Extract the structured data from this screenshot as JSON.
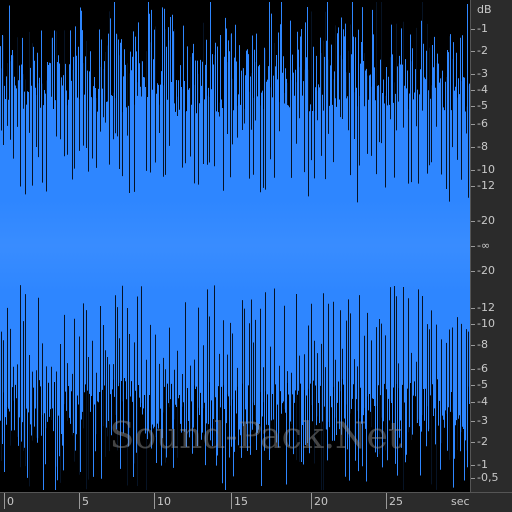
{
  "colors": {
    "background": "#000000",
    "waveform": "#2e86ff",
    "ruler_bg": "#2b2b2b",
    "ruler_text": "#c8c8c8"
  },
  "watermark": "Sound-Pack.Net",
  "db_ruler": {
    "unit": "dB",
    "labels": [
      "-1",
      "-2",
      "-3",
      "-4",
      "-5",
      "-6",
      "-8",
      "-10",
      "-12",
      "-20",
      "-∞",
      "-20",
      "-12",
      "-10",
      "-8",
      "-6",
      "-5",
      "-4",
      "-3",
      "-2",
      "-1",
      "-0,5"
    ]
  },
  "time_ruler": {
    "unit": "sec",
    "labels": [
      "0",
      "5",
      "10",
      "15",
      "20",
      "25"
    ]
  }
}
